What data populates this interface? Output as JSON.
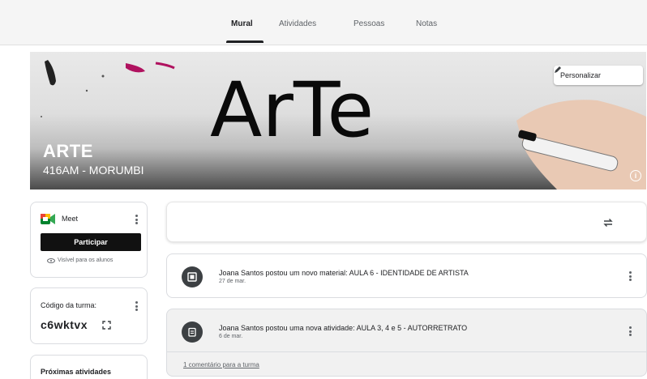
{
  "nav": {
    "tabs": [
      {
        "label": "Mural"
      },
      {
        "label": "Atividades"
      },
      {
        "label": "Pessoas"
      },
      {
        "label": "Notas"
      }
    ],
    "active_tab": "Mural"
  },
  "banner": {
    "artwork_text": "ArTe",
    "title": "ARTE",
    "subtitle": "416AM - MORUMBI",
    "customize_label": "Personalizar",
    "info_icon": "info-icon"
  },
  "meet": {
    "label": "Meet",
    "join_label": "Participar",
    "visibility_note": "Visível para os alunos"
  },
  "class_code": {
    "label": "Código da turma:",
    "value": "c6wktvx"
  },
  "upcoming": {
    "label": "Próximas atividades"
  },
  "stream": {
    "posts": [
      {
        "title": "Joana Santos postou um novo material: AULA 6 - IDENTIDADE DE ARTISTA",
        "date": "27 de mar.",
        "icon": "material-icon"
      },
      {
        "title": "Joana Santos postou uma nova atividade: AULA 3, 4 e 5 - AUTORRETRATO",
        "date": "6 de mar.",
        "icon": "assignment-icon",
        "comment_link": "1 comentário para a turma"
      }
    ]
  },
  "colors": {
    "accent": "#202124",
    "join_button": "#111111",
    "paint_magenta": "#b0125f"
  }
}
